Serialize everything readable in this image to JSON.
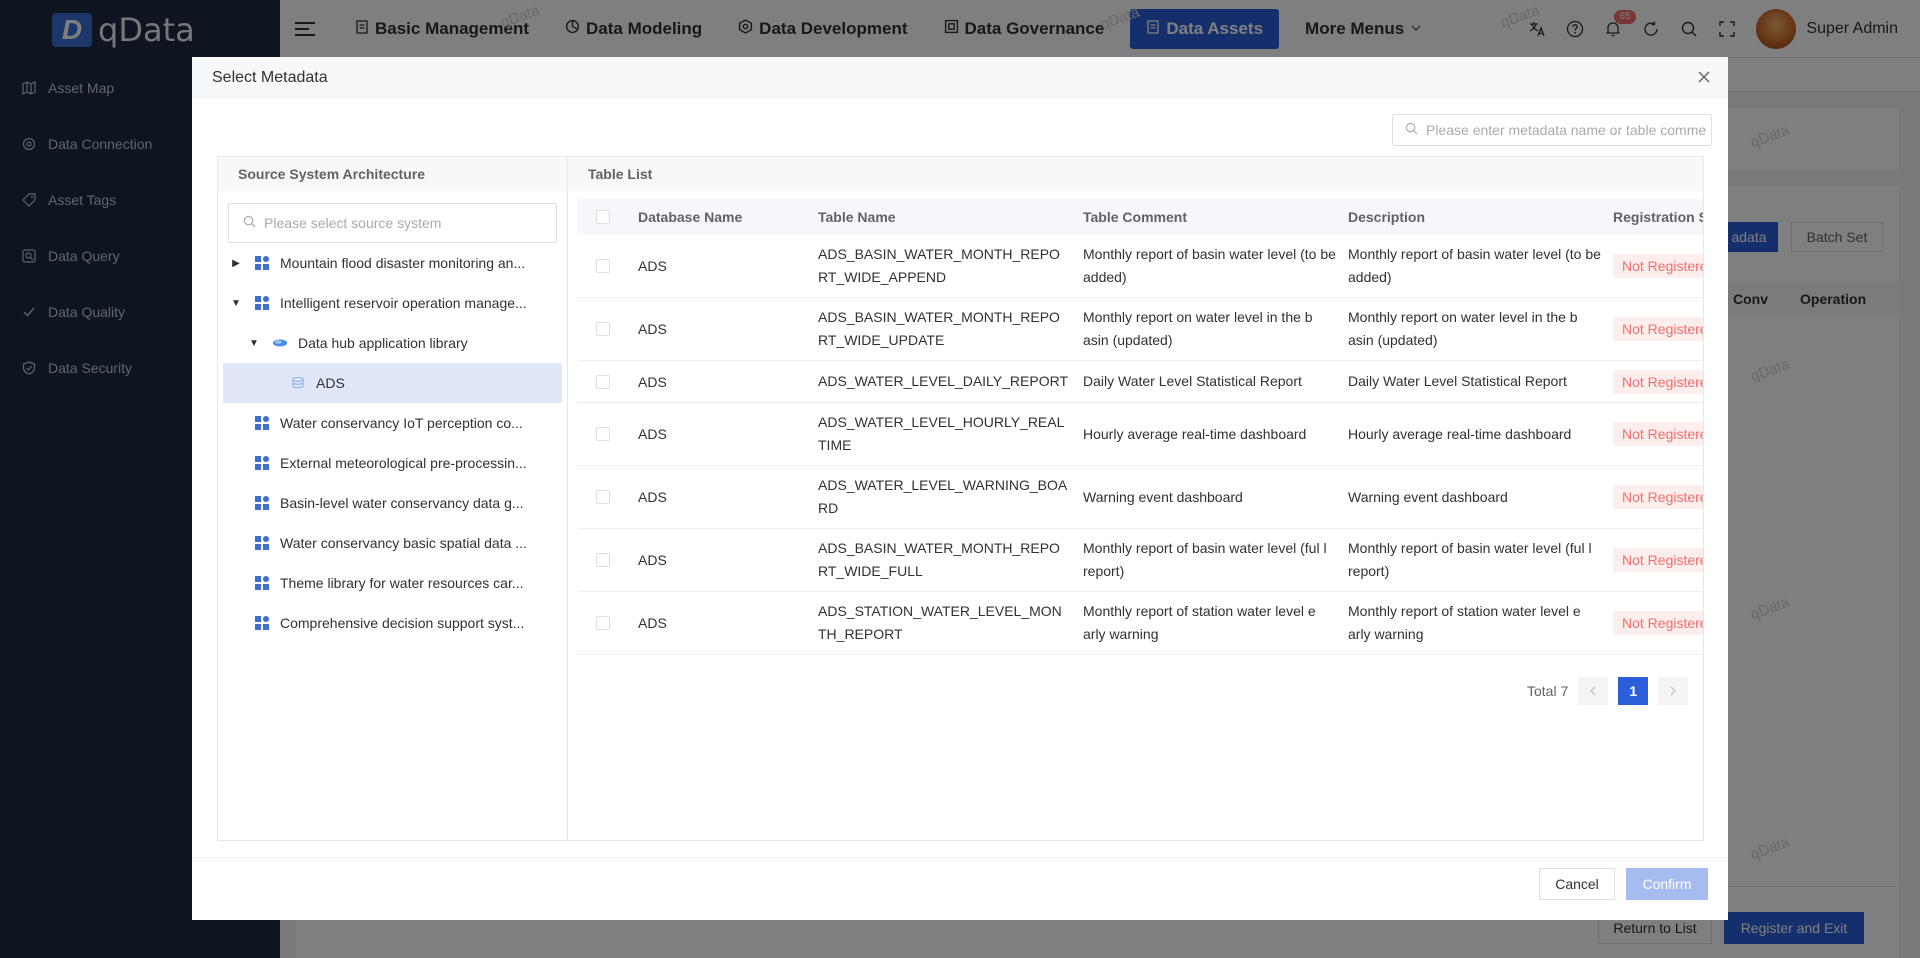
{
  "app": {
    "logo_letter": "D",
    "logo_text": "qData",
    "watermark": "qData"
  },
  "sidebar": {
    "items": [
      {
        "label": "Asset Map",
        "icon": "map-icon"
      },
      {
        "label": "Data Connection",
        "icon": "connection-icon"
      },
      {
        "label": "Asset Tags",
        "icon": "tag-icon"
      },
      {
        "label": "Data Query",
        "icon": "query-icon"
      },
      {
        "label": "Data Quality",
        "icon": "quality-icon"
      },
      {
        "label": "Data Security",
        "icon": "shield-icon"
      }
    ]
  },
  "navbar": {
    "menus": [
      {
        "label": "Basic Management",
        "icon": "management-icon"
      },
      {
        "label": "Data Modeling",
        "icon": "modeling-icon"
      },
      {
        "label": "Data Development",
        "icon": "development-icon"
      },
      {
        "label": "Data Governance",
        "icon": "governance-icon"
      },
      {
        "label": "Data Assets",
        "icon": "assets-icon"
      },
      {
        "label": "More Menus",
        "icon": "chevron-down-icon"
      }
    ],
    "active_menu": "Data Assets",
    "notification_count": "65",
    "user_name": "Super Admin"
  },
  "background_page": {
    "register_button": "adata",
    "batch_set_button": "Batch Set",
    "column_partial": "ng Conv",
    "column_operation": "Operation",
    "return_button": "Return to List",
    "register_exit_button": "Register and Exit"
  },
  "dialog": {
    "title": "Select Metadata",
    "search_placeholder": "Please enter metadata name or table comme",
    "left_title": "Source System Architecture",
    "tree_search_placeholder": "Please select source system",
    "tree": [
      {
        "label": "Mountain flood disaster monitoring an...",
        "level": 0,
        "arrow": "right",
        "icon": "system-icon"
      },
      {
        "label": "Intelligent reservoir operation manage...",
        "level": 0,
        "arrow": "down",
        "icon": "system-icon"
      },
      {
        "label": "Data hub application library",
        "level": 1,
        "arrow": "down",
        "icon": "database-icon"
      },
      {
        "label": "ADS",
        "level": 2,
        "arrow": "",
        "icon": "schema-icon",
        "selected": true
      },
      {
        "label": "Water conservancy IoT perception co...",
        "level": 0,
        "arrow": "",
        "icon": "system-icon"
      },
      {
        "label": "External meteorological pre-processin...",
        "level": 0,
        "arrow": "",
        "icon": "system-icon"
      },
      {
        "label": "Basin-level water conservancy data g...",
        "level": 0,
        "arrow": "",
        "icon": "system-icon"
      },
      {
        "label": "Water conservancy basic spatial data ...",
        "level": 0,
        "arrow": "",
        "icon": "system-icon"
      },
      {
        "label": "Theme library for water resources car...",
        "level": 0,
        "arrow": "",
        "icon": "system-icon"
      },
      {
        "label": "Comprehensive decision support syst...",
        "level": 0,
        "arrow": "",
        "icon": "system-icon"
      }
    ],
    "right_title": "Table List",
    "columns": [
      "Database Name",
      "Table Name",
      "Table Comment",
      "Description",
      "Registration S"
    ],
    "rows": [
      {
        "db": "ADS",
        "table": "ADS_BASIN_WATER_MONTH_REPO RT_WIDE_APPEND",
        "comment": "Monthly report of basin water level (to be added)",
        "description": "Monthly report of basin water level (to be added)",
        "status": "Not Registered"
      },
      {
        "db": "ADS",
        "table": "ADS_BASIN_WATER_MONTH_REPO RT_WIDE_UPDATE",
        "comment": "Monthly report on water level in the b asin (updated)",
        "description": "Monthly report on water level in the b asin (updated)",
        "status": "Not Registered"
      },
      {
        "db": "ADS",
        "table": "ADS_WATER_LEVEL_DAILY_REPORT",
        "comment": "Daily Water Level Statistical Report",
        "description": "Daily Water Level Statistical Report",
        "status": "Not Registered"
      },
      {
        "db": "ADS",
        "table": "ADS_WATER_LEVEL_HOURLY_REAL TIME",
        "comment": "Hourly average real-time dashboard",
        "description": "Hourly average real-time dashboard",
        "status": "Not Registered"
      },
      {
        "db": "ADS",
        "table": "ADS_WATER_LEVEL_WARNING_BOA RD",
        "comment": "Warning event dashboard",
        "description": "Warning event dashboard",
        "status": "Not Registered"
      },
      {
        "db": "ADS",
        "table": "ADS_BASIN_WATER_MONTH_REPO RT_WIDE_FULL",
        "comment": "Monthly report of basin water level (ful l report)",
        "description": "Monthly report of basin water level (ful l report)",
        "status": "Not Registered"
      },
      {
        "db": "ADS",
        "table": "ADS_STATION_WATER_LEVEL_MON TH_REPORT",
        "comment": "Monthly report of station water level e arly warning",
        "description": "Monthly report of station water level e arly warning",
        "status": "Not Registered"
      }
    ],
    "total_label": "Total 7",
    "current_page": "1",
    "cancel_label": "Cancel",
    "confirm_label": "Confirm"
  },
  "colors": {
    "sidebar_bg": "#1d2a3c",
    "primary": "#2b5fd9",
    "tag_red": "#f56c6c",
    "tree_selected": "#dfe7f9"
  }
}
